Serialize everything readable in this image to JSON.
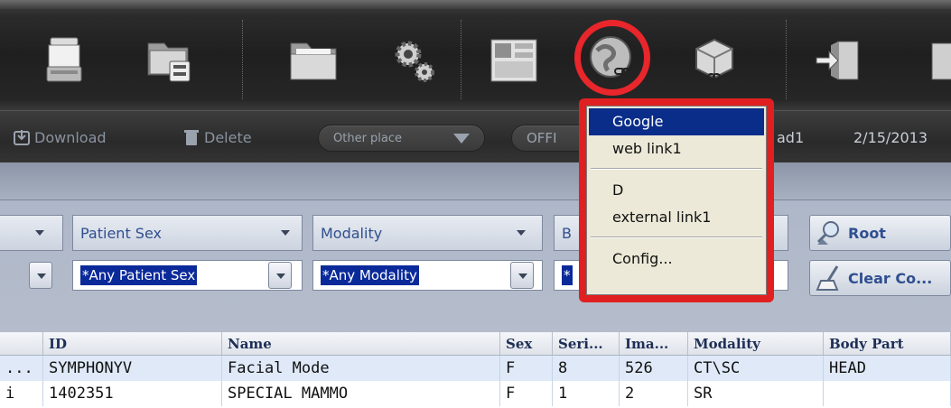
{
  "toolbar": {
    "icons": [
      {
        "name": "scanner-icon"
      },
      {
        "name": "server-folder-icon"
      },
      {
        "name": "folder-icon"
      },
      {
        "name": "gears-icon"
      },
      {
        "name": "layout-icon"
      },
      {
        "name": "web-link-icon",
        "highlighted": true
      },
      {
        "name": "3d-cube-icon"
      },
      {
        "name": "exit-door-icon"
      }
    ],
    "highlight_color": "#e8262b"
  },
  "actions": {
    "download_label": "Download",
    "delete_label": "Delete",
    "other_place_label": "Other place",
    "office_label": "OFFI",
    "user_label": "ad1",
    "date_label": "2/15/2013"
  },
  "filters": {
    "headers": {
      "patient_sex": "Patient Sex",
      "modality": "Modality",
      "body_part_partial": "B"
    },
    "values": {
      "patient_sex": "*Any Patient Sex",
      "modality": "*Any Modality",
      "body_part_partial": "*"
    },
    "buttons": {
      "root": "Root",
      "clear": "Clear Co..."
    }
  },
  "table": {
    "columns": [
      "ID",
      "Name",
      "Sex",
      "Seri...",
      "Ima...",
      "Modality",
      "Body Part"
    ],
    "rows": [
      {
        "lead": "...",
        "id": "SYMPHONYV",
        "name": "Facial Mode",
        "sex": "F",
        "series": "8",
        "images": "526",
        "modality": "CT\\SC",
        "body_part": "HEAD"
      },
      {
        "lead": "i",
        "id": "1402351",
        "name": "SPECIAL MAMMO",
        "sex": "F",
        "series": "1",
        "images": "2",
        "modality": "SR",
        "body_part": ""
      }
    ]
  },
  "menu": {
    "items": [
      {
        "label": "Google",
        "selected": true
      },
      {
        "label": "web link1"
      },
      {
        "label": "D"
      },
      {
        "label": "external link1"
      },
      {
        "label": "Config..."
      }
    ],
    "border_color": "#e02020",
    "selection_color": "#0a2d8a"
  }
}
